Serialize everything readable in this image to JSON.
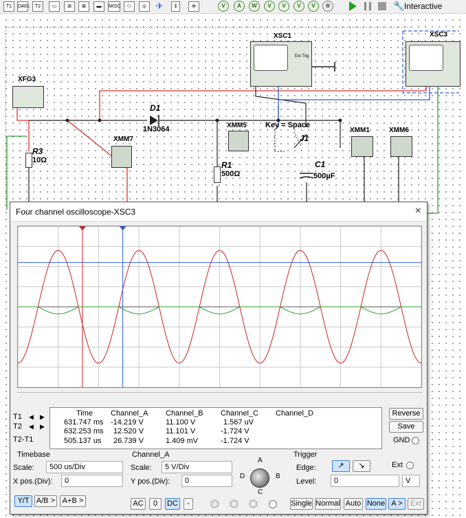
{
  "toolbar": {
    "icons": [
      "T1",
      "MS",
      "F",
      "T2",
      "MISC",
      "PWR",
      "RF",
      "MECH",
      "V",
      "V",
      "V",
      "V",
      "V",
      "V",
      "V",
      "V"
    ],
    "mode_label": "Interactive",
    "tb_icon_labels": [
      "T1",
      "D481",
      "T2",
      "",
      "MISC",
      "",
      "",
      "",
      ""
    ]
  },
  "schematic": {
    "xfg_label": "XFG3",
    "xsc1_label": "XSC1",
    "xsc3_label": "XSC3",
    "ext_trig": "Ext Trig",
    "d1_label": "D1",
    "d1_value": "1N3064",
    "r3_label": "R3",
    "r3_value": "10Ω",
    "xmm7_label": "XMM7",
    "xmm5_label": "XMM5",
    "r1_label": "R1",
    "r1_value": "500Ω",
    "key_label": "Key = Space",
    "j1_label": "J1",
    "c1_label": "C1",
    "c1_value": "500µF",
    "xmm1_label": "XMM1",
    "xmm6_label": "XMM6"
  },
  "scope": {
    "title": "Four channel oscilloscope-XSC3",
    "close_icon": "×",
    "cursor1_label": "1",
    "cursor2_label": "2",
    "readout": {
      "headers": [
        "Time",
        "Channel_A",
        "Channel_B",
        "Channel_C",
        "Channel_D"
      ],
      "rows": [
        {
          "label": "T1",
          "time": "631.747 ms",
          "a": "-14.219 V",
          "b": "11.100 V",
          "c": "1.567 uV",
          "d": ""
        },
        {
          "label": "T2",
          "time": "632.253 ms",
          "a": "12.520 V",
          "b": "11.101 V",
          "c": "-1.724 V",
          "d": ""
        },
        {
          "label": "T2-T1",
          "time": "505.137 us",
          "a": "26.739 V",
          "b": "1.409 mV",
          "c": "-1.724 V",
          "d": ""
        }
      ]
    },
    "buttons": {
      "reverse": "Reverse",
      "save": "Save",
      "gnd": "GND"
    },
    "timebase": {
      "title": "Timebase",
      "scale_label": "Scale:",
      "scale_value": "500 us/Div",
      "xpos_label": "X pos.(Div):",
      "xpos_value": "0",
      "modes": [
        "Y/T",
        "A/B >",
        "A+B >"
      ]
    },
    "channel": {
      "title": "Channel_A",
      "scale_label": "Scale:",
      "scale_value": "5  V/Div",
      "ypos_label": "Y pos.(Div):",
      "ypos_value": "0",
      "coupling": [
        "AC",
        "0",
        "DC",
        "-"
      ],
      "knob_letters": {
        "a": "A",
        "b": "B",
        "c": "C",
        "d": "D"
      }
    },
    "trigger": {
      "title": "Trigger",
      "edge_label": "Edge:",
      "edge_rise": "↗",
      "edge_fall": "↘",
      "ext_label": "Ext",
      "level_label": "Level:",
      "level_value": "0",
      "level_unit": "V",
      "modes": [
        "Single",
        "Normal",
        "Auto",
        "None",
        "A >",
        "Ext"
      ]
    }
  },
  "chart_data": {
    "type": "line",
    "title": "",
    "xlabel": "",
    "ylabel": "",
    "x_range_divs": [
      0,
      10
    ],
    "y_range_divs": [
      -4,
      4
    ],
    "grid": true,
    "series": [
      {
        "name": "Channel_A",
        "color": "#cc2222",
        "kind": "sine",
        "amplitude_divs": 2.8,
        "period_divs": 2.0,
        "phase_divs": 0.0
      },
      {
        "name": "Channel_B",
        "color": "#2d5bd6",
        "kind": "dc",
        "level_divs": 2.2
      },
      {
        "name": "Channel_C",
        "color": "#2aa12a",
        "kind": "clipped_neg",
        "amplitude_divs": 0.35,
        "period_divs": 2.0,
        "phase_divs": 0.0
      }
    ],
    "cursors": [
      {
        "name": "T1",
        "color": "#cc2222",
        "x_div": 1.6
      },
      {
        "name": "T2",
        "color": "#2d5bd6",
        "x_div": 2.6
      }
    ],
    "colors": {
      "grid": "#c8c8c8",
      "axis": "#555555"
    }
  }
}
